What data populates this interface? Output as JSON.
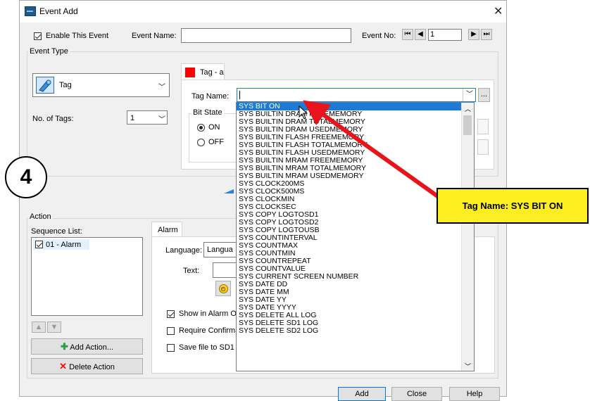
{
  "window": {
    "title": "Event Add",
    "close_glyph": "✕"
  },
  "header": {
    "enable_label": "Enable This Event",
    "event_name_label": "Event Name:",
    "event_name_value": "",
    "event_no_label": "Event No:",
    "event_no_value": "1"
  },
  "event_type": {
    "group_label": "Event Type",
    "type_value": "Tag",
    "no_of_tags_label": "No. of Tags:",
    "no_of_tags_value": "1",
    "tab_label": "Tag - a",
    "tag_name_label": "Tag Name:",
    "tag_name_value": "",
    "browse_label": "...",
    "bit_state_label": "Bit State",
    "on_label": "ON",
    "off_label": "OFF",
    "tab_color": "#ff0000"
  },
  "action": {
    "group_label": "Action",
    "sequence_list_label": "Sequence List:",
    "sequence_items": [
      "01 - Alarm"
    ],
    "tab_label": "Alarm",
    "language_label": "Language:",
    "language_value": "Langua",
    "text_label": "Text:",
    "show_alarm_label": "Show in Alarm O",
    "require_confirm_label": "Require Confirma",
    "save_file_label": "Save file to SD1",
    "add_action_label": "Add Action...",
    "delete_action_label": "Delete Action"
  },
  "dropdown": {
    "selected_index": 0,
    "items": [
      "SYS BIT ON",
      "SYS BUILTIN DRAM FREEMEMORY",
      "SYS BUILTIN DRAM TOTALMEMORY",
      "SYS BUILTIN DRAM USEDMEMORY",
      "SYS BUILTIN FLASH FREEMEMORY",
      "SYS BUILTIN FLASH TOTALMEMORY",
      "SYS BUILTIN FLASH USEDMEMORY",
      "SYS BUILTIN MRAM FREEMEMORY",
      "SYS BUILTIN MRAM TOTALMEMORY",
      "SYS BUILTIN MRAM USEDMEMORY",
      "SYS CLOCK200MS",
      "SYS CLOCK500MS",
      "SYS CLOCKMIN",
      "SYS CLOCKSEC",
      "SYS COPY LOGTOSD1",
      "SYS COPY LOGTOSD2",
      "SYS COPY LOGTOUSB",
      "SYS COUNTINTERVAL",
      "SYS COUNTMAX",
      "SYS COUNTMIN",
      "SYS COUNTREPEAT",
      "SYS COUNTVALUE",
      "SYS CURRENT SCREEN NUMBER",
      "SYS DATE DD",
      "SYS DATE MM",
      "SYS DATE YY",
      "SYS DATE YYYY",
      "SYS DELETE ALL LOG",
      "SYS DELETE SD1 LOG",
      "SYS DELETE SD2 LOG"
    ]
  },
  "footer": {
    "add_label": "Add",
    "close_label": "Close",
    "help_label": "Help"
  },
  "annotation": {
    "step_number": "4",
    "callout_text": "Tag Name: SYS BIT ON",
    "arrow_color": "#e8141a",
    "callout_color": "#fcee21"
  }
}
